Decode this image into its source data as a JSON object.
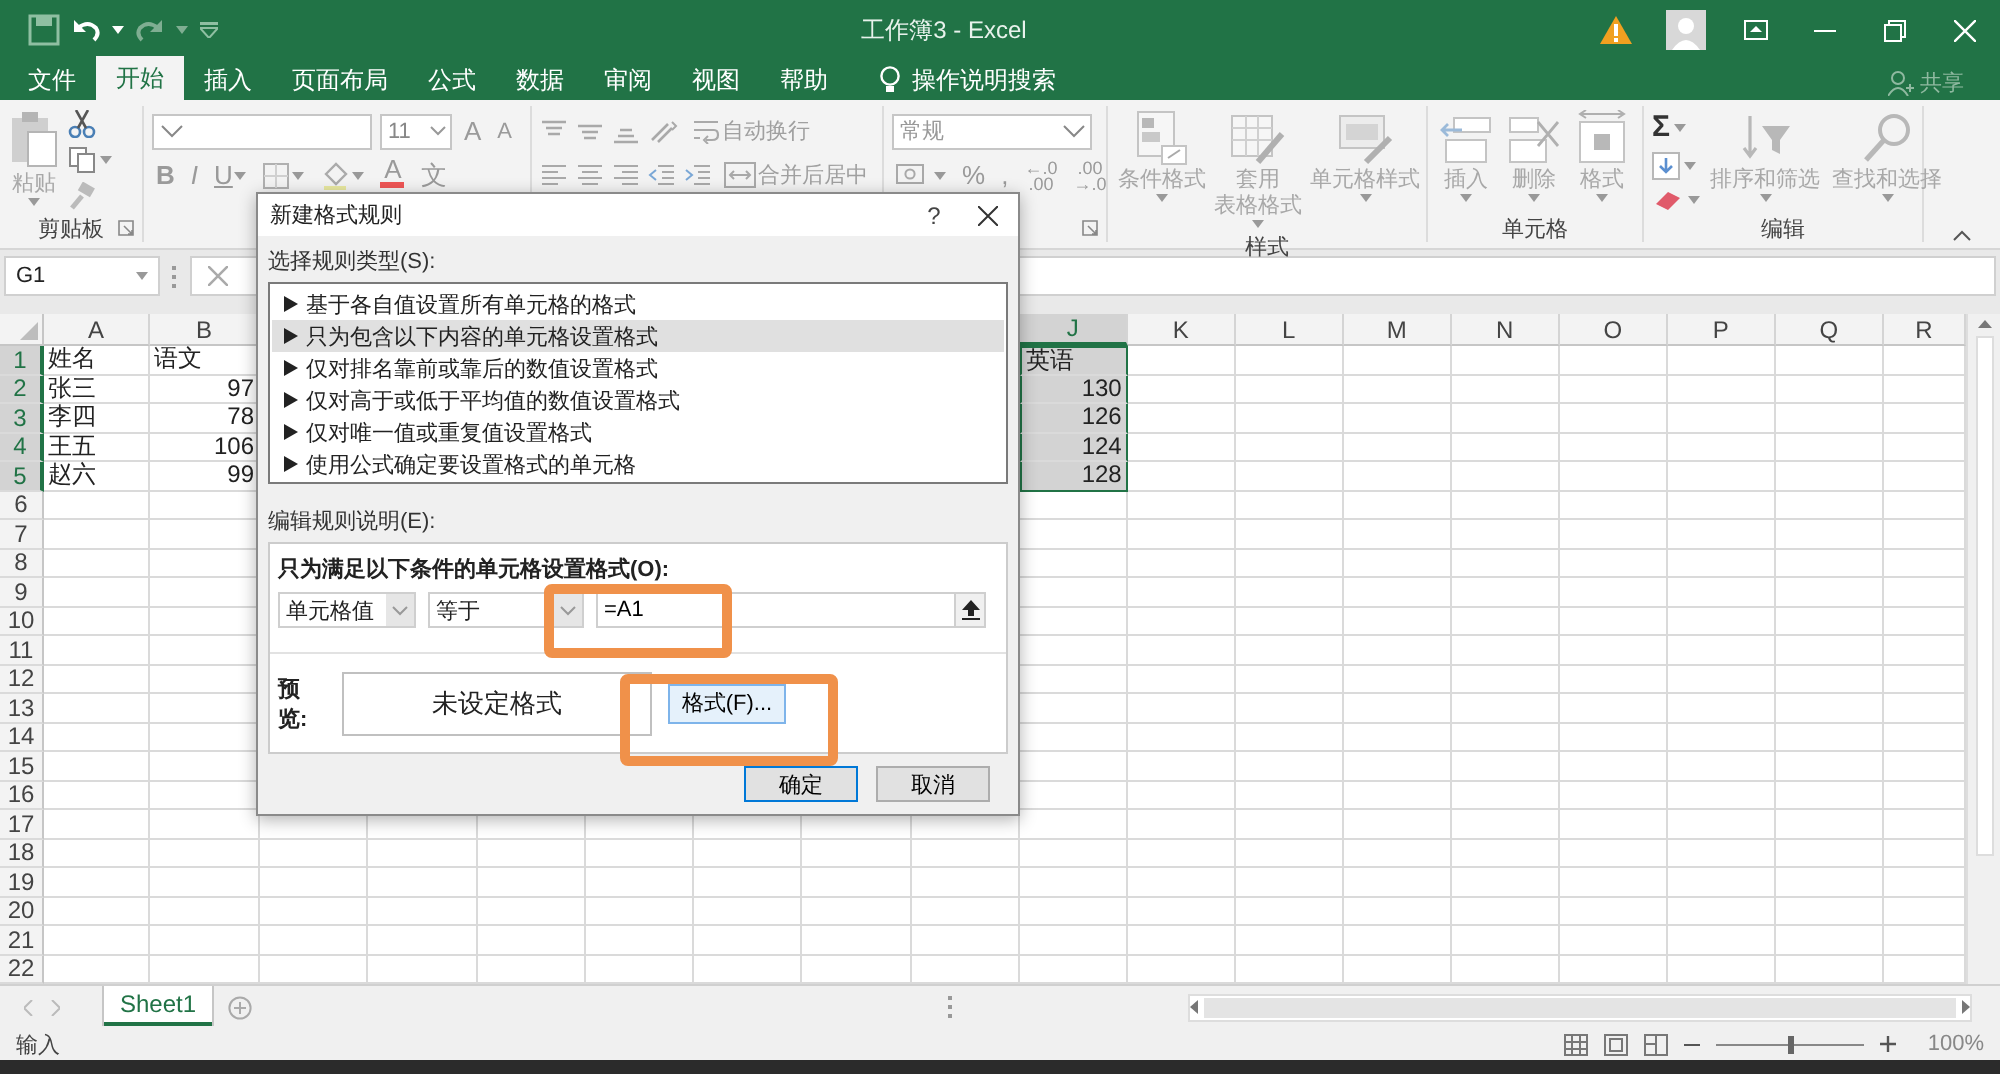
{
  "window": {
    "title": "工作簿3 - Excel"
  },
  "tabs": [
    {
      "label": "文件",
      "selected": false
    },
    {
      "label": "开始",
      "selected": true
    },
    {
      "label": "插入",
      "selected": false
    },
    {
      "label": "页面布局",
      "selected": false
    },
    {
      "label": "公式",
      "selected": false
    },
    {
      "label": "数据",
      "selected": false
    },
    {
      "label": "审阅",
      "selected": false
    },
    {
      "label": "视图",
      "selected": false
    },
    {
      "label": "帮助",
      "selected": false
    }
  ],
  "tell_me": {
    "placeholder": "操作说明搜索"
  },
  "share": "共享",
  "ribbon": {
    "clipboard": {
      "paste": "粘贴",
      "paste_disabled": true,
      "label": "剪贴板"
    },
    "font": {
      "size": "11",
      "grow": "A",
      "shrink": "A",
      "bold": "B",
      "italic": "I",
      "underline": "U",
      "font_color": "A",
      "phonetic": "文"
    },
    "alignment": {
      "wrap_text": "自动换行",
      "merge": "合并后居中"
    },
    "number": {
      "format": "常规",
      "percent": "%",
      "comma": ",",
      "increase_decimal": "←.0\n.00",
      "decrease_decimal": ".00\n→.0"
    },
    "styles": {
      "label": "样式",
      "buttons": [
        {
          "label": "条件格式",
          "disabled": true
        },
        {
          "label": "套用",
          "label_2": "表格格式",
          "disabled": true
        },
        {
          "label": "单元格样式",
          "disabled": true
        }
      ]
    },
    "cells": {
      "label": "单元格",
      "buttons": [
        {
          "label": "插入",
          "disabled": true
        },
        {
          "label": "删除",
          "disabled": true
        },
        {
          "label": "格式",
          "disabled": true
        }
      ]
    },
    "editing": {
      "label": "编辑",
      "autosum": "Σ",
      "buttons": [
        {
          "label": "排序和筛选",
          "disabled": true
        },
        {
          "label": "查找和选择",
          "disabled": true
        }
      ]
    }
  },
  "formula_bar": {
    "name_box": "G1"
  },
  "sheet": {
    "columns": [
      {
        "label": "A",
        "selected": false
      },
      {
        "label": "B",
        "selected": false
      },
      {
        "label": "J",
        "selected": true
      },
      {
        "label": "K",
        "selected": false
      },
      {
        "label": "L",
        "selected": false
      },
      {
        "label": "M",
        "selected": false
      },
      {
        "label": "N",
        "selected": false
      },
      {
        "label": "O",
        "selected": false
      },
      {
        "label": "P",
        "selected": false
      },
      {
        "label": "Q",
        "selected": false
      },
      {
        "label": "R",
        "selected": false
      }
    ],
    "rows": [
      {
        "header": "1",
        "selected": true,
        "cells": [
          {
            "text": "姓名",
            "kind": "text"
          },
          {
            "text": "语文",
            "kind": "text"
          },
          {
            "text": "英语",
            "kind": "text"
          }
        ]
      },
      {
        "header": "2",
        "selected": true,
        "cells": [
          {
            "text": "张三",
            "kind": "text"
          },
          {
            "text": "97",
            "kind": "number"
          },
          {
            "text": "130",
            "kind": "number"
          }
        ]
      },
      {
        "header": "3",
        "selected": true,
        "cells": [
          {
            "text": "李四",
            "kind": "text"
          },
          {
            "text": "78",
            "kind": "number"
          },
          {
            "text": "126",
            "kind": "number"
          }
        ]
      },
      {
        "header": "4",
        "selected": true,
        "cells": [
          {
            "text": "王五",
            "kind": "text"
          },
          {
            "text": "106",
            "kind": "number"
          },
          {
            "text": "124",
            "kind": "number"
          }
        ]
      },
      {
        "header": "5",
        "selected": true,
        "cells": [
          {
            "text": "赵六",
            "kind": "text"
          },
          {
            "text": "99",
            "kind": "number"
          },
          {
            "text": "128",
            "kind": "number"
          }
        ]
      },
      {
        "header": "6",
        "selected": false
      },
      {
        "header": "7",
        "selected": false
      },
      {
        "header": "8",
        "selected": false
      },
      {
        "header": "9",
        "selected": false
      },
      {
        "header": "10",
        "selected": false
      },
      {
        "header": "11",
        "selected": false
      },
      {
        "header": "12",
        "selected": false
      },
      {
        "header": "13",
        "selected": false
      },
      {
        "header": "14",
        "selected": false
      },
      {
        "header": "15",
        "selected": false
      },
      {
        "header": "16",
        "selected": false
      },
      {
        "header": "17",
        "selected": false
      },
      {
        "header": "18",
        "selected": false
      },
      {
        "header": "19",
        "selected": false
      },
      {
        "header": "20",
        "selected": false
      },
      {
        "header": "21",
        "selected": false
      },
      {
        "header": "22",
        "selected": false
      }
    ]
  },
  "sheet_tabs": [
    {
      "label": "Sheet1",
      "selected": true
    }
  ],
  "status_bar": {
    "mode": "输入",
    "zoom": "100%",
    "zoom_slider": {
      "level": 0.5
    }
  },
  "dialog": {
    "title": "新建格式规则",
    "help": "?",
    "rule_type_label": "选择规则类型(S):",
    "rule_types": [
      {
        "label": "基于各自值设置所有单元格的格式",
        "selected": false
      },
      {
        "label": "只为包含以下内容的单元格设置格式",
        "selected": true
      },
      {
        "label": "仅对排名靠前或靠后的数值设置格式",
        "selected": false
      },
      {
        "label": "仅对高于或低于平均值的数值设置格式",
        "selected": false
      },
      {
        "label": "仅对唯一值或重复值设置格式",
        "selected": false
      },
      {
        "label": "使用公式确定要设置格式的单元格",
        "selected": false
      }
    ],
    "edit_label": "编辑规则说明(E):",
    "condition_label": "只为满足以下条件的单元格设置格式(O):",
    "condition": {
      "operand": "单元格值",
      "operator": "等于",
      "value": "=A1"
    },
    "preview_label": "预览:",
    "preview_text": "未设定格式",
    "format_button": "格式(F)...",
    "ok": "确定",
    "cancel": "取消"
  },
  "annotations": [
    {
      "kind": "frame"
    },
    {
      "kind": "frame"
    }
  ]
}
